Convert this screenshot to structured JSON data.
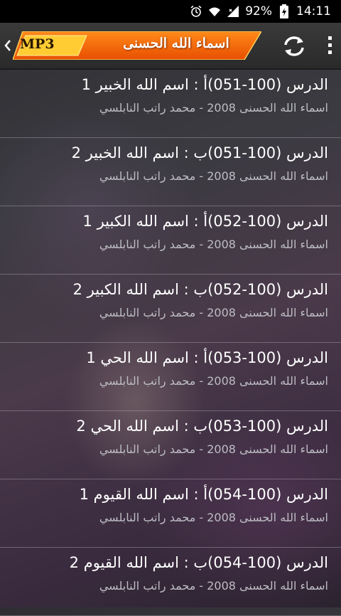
{
  "status_bar": {
    "battery_percent": "92%",
    "time": "14:11",
    "icons": [
      "alarm-icon",
      "wifi-icon",
      "signal-icon",
      "battery-charging-icon"
    ]
  },
  "app_bar": {
    "title": "اسماء الله الحسنى",
    "badge": "MP3",
    "icons": [
      "back-chevron-icon",
      "refresh-icon",
      "overflow-menu-icon"
    ],
    "banner_color": "#ff6a00"
  },
  "lessons": [
    {
      "title": "الدرس (100-051)أ : اسم الله الخبير 1",
      "subtitle": "اسماء الله الحسنى 2008 - محمد راتب النابلسي"
    },
    {
      "title": "الدرس (100-051)ب : اسم الله الخبير 2",
      "subtitle": "اسماء الله الحسنى 2008 - محمد راتب النابلسي"
    },
    {
      "title": "الدرس (100-052)أ : اسم الله الكبير 1",
      "subtitle": "اسماء الله الحسنى 2008 - محمد راتب النابلسي"
    },
    {
      "title": "الدرس (100-052)ب : اسم الله الكبير 2",
      "subtitle": "اسماء الله الحسنى 2008 - محمد راتب النابلسي"
    },
    {
      "title": "الدرس (100-053)أ : اسم الله الحي 1",
      "subtitle": "اسماء الله الحسنى 2008 - محمد راتب النابلسي"
    },
    {
      "title": "الدرس (100-053)ب : اسم الله الحي 2",
      "subtitle": "اسماء الله الحسنى 2008 - محمد راتب النابلسي"
    },
    {
      "title": "الدرس (100-054)أ : اسم الله القيوم 1",
      "subtitle": "اسماء الله الحسنى 2008 - محمد راتب النابلسي"
    },
    {
      "title": "الدرس (100-054)ب : اسم الله القيوم 2",
      "subtitle": "اسماء الله الحسنى 2008 - محمد راتب النابلسي"
    }
  ]
}
